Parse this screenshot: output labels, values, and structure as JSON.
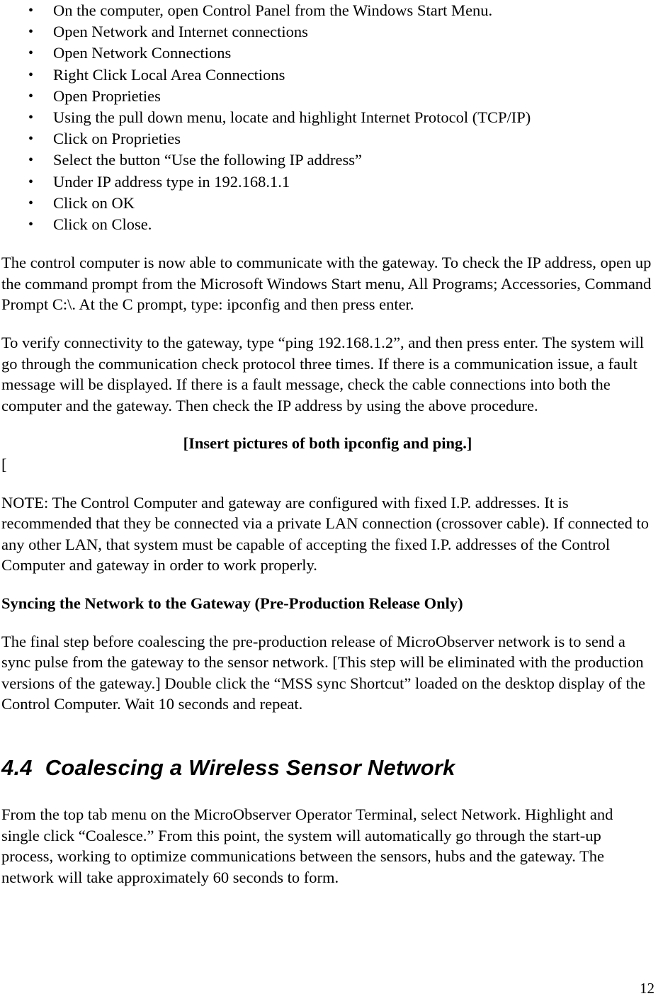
{
  "document": {
    "page_number": "12"
  },
  "steps": {
    "bullet_glyph": "•",
    "items": [
      "On the computer, open Control Panel from the Windows Start Menu.",
      "Open Network and Internet connections",
      "Open Network Connections",
      "Right Click Local Area Connections",
      "Open Proprieties",
      "Using the pull down menu, locate and highlight Internet Protocol (TCP/IP)",
      "Click on Proprieties",
      "Select the button “Use the following IP address”",
      "Under IP address type in 192.168.1.1",
      "Click on OK",
      "Click on Close."
    ]
  },
  "paragraphs": {
    "ipconfig_check": "The control computer is now able to communicate with the gateway.  To check the IP address, open up the command prompt from the Microsoft Windows Start menu, All Programs; Accessories, Command Prompt C:\\.  At the C prompt, type: ipconfig and then press enter.",
    "ping_verify": "To verify connectivity to the gateway, type “ping 192.168.1.2”, and then press enter.  The system will go through the communication check protocol three times.  If there is a communication issue, a fault message will be displayed.  If there is a fault message, check the cable connections into both the computer and the gateway. Then check the IP address by using the above procedure.",
    "insert_pictures_note": "[Insert pictures of both ipconfig and ping.]",
    "stray_bracket": "[",
    "fixed_ip_note": "NOTE:  The Control Computer and gateway are configured with fixed I.P. addresses.  It is recommended that they be connected via a private LAN connection (crossover cable).  If connected to any other LAN, that system must be capable of accepting the fixed I.P. addresses of the Control Computer and gateway in order to work properly.",
    "sync_heading": "Syncing the Network to the Gateway (Pre-Production Release Only)",
    "sync_body": "The final step before coalescing the pre-production release of MicroObserver network is to send a sync pulse from the gateway to the sensor network.   [This step will be eliminated with the production versions of the gateway.]  Double click the “MSS sync Shortcut” loaded on the desktop display of the Control Computer.  Wait 10 seconds and repeat.",
    "coalesce_body": "From the top tab menu on the MicroObserver Operator Terminal, select Network.  Highlight and single click “Coalesce.”  From this point, the system will automatically go through the start-up process, working to optimize communications between the sensors, hubs and the gateway.  The network will take approximately 60 seconds to form."
  },
  "section": {
    "number": "4.4",
    "title": "Coalescing a Wireless Sensor Network"
  }
}
